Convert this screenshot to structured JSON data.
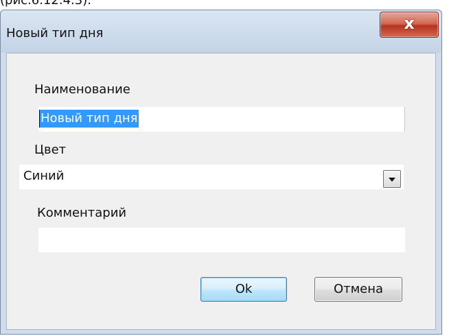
{
  "page_caption": "(рис.6.12.4.3).",
  "dialog": {
    "title": "Новый тип дня",
    "close_label": "x"
  },
  "form": {
    "name_label": "Наименование",
    "name_value": "Новый тип дня",
    "color_label": "Цвет",
    "color_value": "Синий",
    "comment_label": "Комментарий",
    "comment_value": ""
  },
  "buttons": {
    "ok_label": "Ok",
    "cancel_label": "Отмена"
  },
  "colors": {
    "selection": "#3399ff",
    "ok_border": "#3c7fb1",
    "close_button": "#c4412b",
    "dialog_frame": "#cfdcec"
  },
  "icons": {
    "close": "close-icon",
    "dropdown": "chevron-down-icon"
  }
}
